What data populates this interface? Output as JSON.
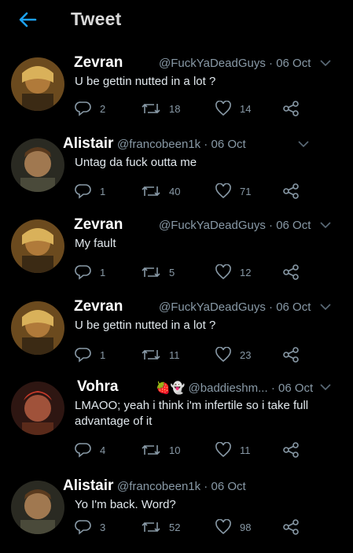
{
  "header": {
    "title": "Tweet"
  },
  "colors": {
    "accent": "#1da1f2",
    "background": "#000000",
    "muted": "#8899a6"
  },
  "tweets": [
    {
      "name": "Zevran",
      "handle": "@FuckYaDeadGuys",
      "date": "06 Oct",
      "text": "U be gettin nutted in a lot ?",
      "replies": "2",
      "retweets": "18",
      "likes": "14",
      "avatar": "zevran-avatar"
    },
    {
      "name": "Alistair",
      "handle": "@francobeen1k",
      "date": "06 Oct",
      "text": "Untag da fuck outta me",
      "replies": "1",
      "retweets": "40",
      "likes": "71",
      "avatar": "alistair-avatar"
    },
    {
      "name": "Zevran",
      "handle": "@FuckYaDeadGuys",
      "date": "06 Oct",
      "text": "My fault",
      "replies": "1",
      "retweets": "5",
      "likes": "12",
      "avatar": "zevran-avatar"
    },
    {
      "name": "Zevran",
      "handle": "@FuckYaDeadGuys",
      "date": "06 Oct",
      "text": "U be gettin nutted in a lot ?",
      "replies": "1",
      "retweets": "11",
      "likes": "23",
      "avatar": "zevran-avatar"
    },
    {
      "name": "Vohra",
      "emojis": "🍓👻",
      "handle": "@baddieshm...",
      "date": "06 Oct",
      "text": "LMAOO; yeah i think i'm infertile so i take full advantage of it",
      "replies": "4",
      "retweets": "10",
      "likes": "11",
      "avatar": "vohra-avatar"
    },
    {
      "name": "Alistair",
      "handle": "@francobeen1k",
      "date": "06 Oct",
      "text": "Yo I'm back. Word?",
      "replies": "3",
      "retweets": "52",
      "likes": "98",
      "avatar": "alistair-avatar"
    }
  ]
}
